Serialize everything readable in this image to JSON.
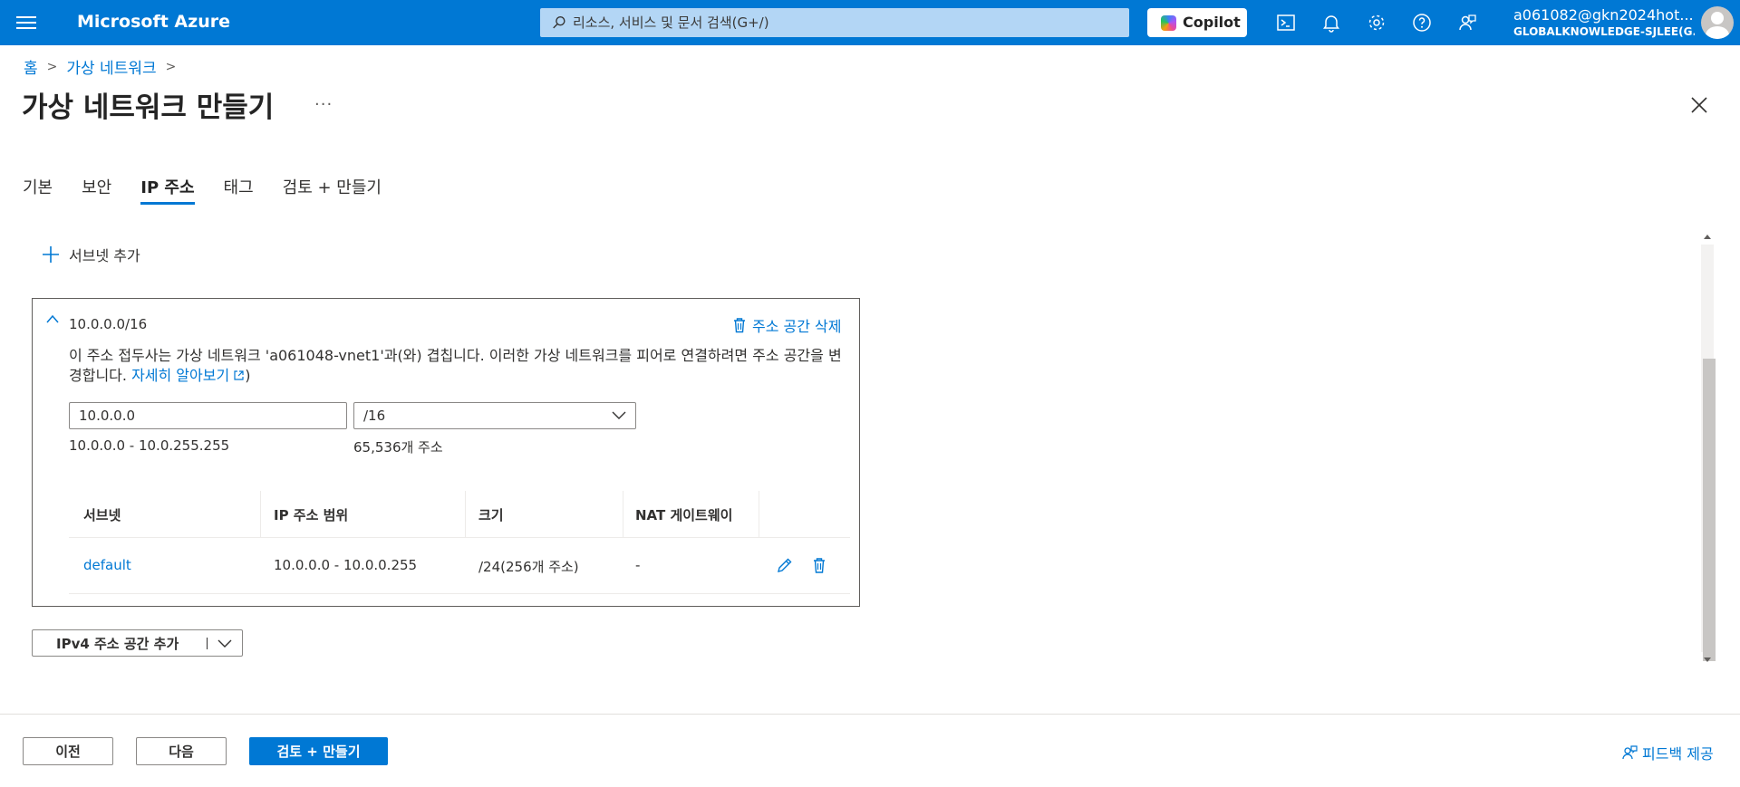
{
  "topbar": {
    "brand": "Microsoft Azure",
    "search_placeholder": "리소스, 서비스 및 문서 검색(G+/)",
    "copilot_label": "Copilot",
    "user_email": "a061082@gkn2024hot...",
    "user_org": "GLOBALKNOWLEDGE-SJLEE(G..."
  },
  "breadcrumb": {
    "items": [
      "홈",
      "가상 네트워크"
    ]
  },
  "page": {
    "title": "가상 네트워크 만들기",
    "more": "..."
  },
  "tabs": [
    "기본",
    "보안",
    "IP 주소",
    "태그",
    "검토 + 만들기"
  ],
  "active_tab": "IP 주소",
  "add_subnet_label": "서브넷 추가",
  "address_space": {
    "header": "10.0.0.0/16",
    "delete_label": "주소 공간 삭제",
    "warning_text": "이 주소 접두사는 가상 네트워크 'a061048-vnet1'과(와) 겹칩니다. 이러한 가상 네트워크를 피어로 연결하려면 주소 공간을 변경합니다.",
    "learn_more": "자세히 알아보기",
    "close_paren": ")",
    "ip_value": "10.0.0.0",
    "prefix_value": "/16",
    "range": "10.0.0.0 - 10.0.255.255",
    "count": "65,536개 주소"
  },
  "subnet_table": {
    "headers": [
      "서브넷",
      "IP 주소 범위",
      "크기",
      "NAT 게이트웨이"
    ],
    "rows": [
      {
        "name": "default",
        "range": "10.0.0.0 - 10.0.0.255",
        "size": "/24(256개 주소)",
        "nat": "-"
      }
    ]
  },
  "add_ipv4_label": "IPv4 주소 공간 추가",
  "footer": {
    "prev": "이전",
    "next": "다음",
    "review_create": "검토 + 만들기",
    "feedback": "피드백 제공"
  },
  "colors": {
    "brand_blue": "#0078d4",
    "border": "#8a8886"
  }
}
